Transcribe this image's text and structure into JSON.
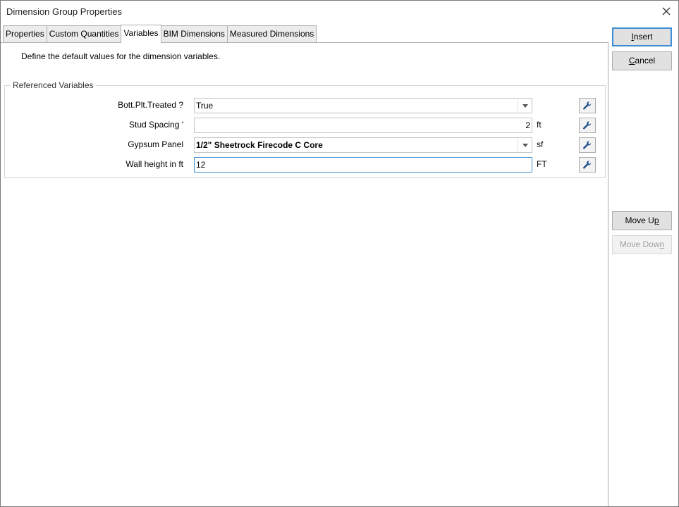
{
  "window": {
    "title": "Dimension Group Properties"
  },
  "tabs": [
    {
      "label": "Properties",
      "active": false
    },
    {
      "label": "Custom Quantities",
      "active": false
    },
    {
      "label": "Variables",
      "active": true
    },
    {
      "label": "BIM Dimensions",
      "active": false
    },
    {
      "label": "Measured Dimensions",
      "active": false
    }
  ],
  "variables_tab": {
    "description": "Define the default values for the dimension variables.",
    "group_title": "Referenced Variables",
    "rows": [
      {
        "label": "Bott.Plt.Treated ?",
        "value": "True",
        "type": "dropdown",
        "unit": ""
      },
      {
        "label": "Stud Spacing '",
        "value": "2",
        "type": "number",
        "unit": "ft"
      },
      {
        "label": "Gypsum Panel",
        "value": "1/2\" Sheetrock Firecode C Core",
        "type": "dropdown",
        "unit": "sf"
      },
      {
        "label": "Wall height in ft",
        "value": "12",
        "type": "text",
        "unit": "FT"
      }
    ]
  },
  "buttons": {
    "insert": {
      "pre": "",
      "key": "I",
      "post": "nsert"
    },
    "cancel": {
      "pre": "",
      "key": "C",
      "post": "ancel"
    },
    "move_up": {
      "pre": "Move U",
      "key": "p",
      "post": ""
    },
    "move_down": {
      "pre": "Move Dow",
      "key": "n",
      "post": ""
    }
  },
  "icons": {
    "close": "close-icon",
    "dropdown": "chevron-down-icon",
    "edit": "wrench-icon"
  },
  "colors": {
    "focus_border": "#3d8ed6",
    "button_face": "#e1e1e1",
    "tab_inactive": "#ececec"
  }
}
